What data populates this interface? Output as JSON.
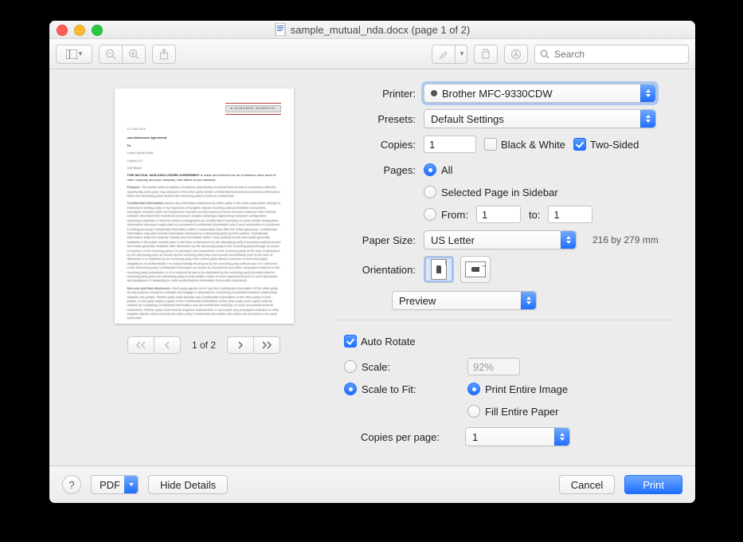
{
  "titlebar": {
    "title": "sample_mutual_nda.docx (page 1 of 2)"
  },
  "toolbar": {
    "search_placeholder": "Search"
  },
  "preview": {
    "page_indicator": "1 of 2",
    "thumb": {
      "logo": "A HUNDRED MONKEYS",
      "date": "10 JUN 2019",
      "heading": "non-disclosure agreement",
      "to_label": "To",
      "block1_title": "THIS MUTUAL NON-DISCLOSURE AGREEMENT"
    }
  },
  "form": {
    "printer": {
      "label": "Printer:",
      "value": "Brother MFC-9330CDW"
    },
    "presets": {
      "label": "Presets:",
      "value": "Default Settings"
    },
    "copies": {
      "label": "Copies:",
      "value": "1",
      "bw_label": "Black & White",
      "two_sided_label": "Two-Sided"
    },
    "pages": {
      "label": "Pages:",
      "all_label": "All",
      "selected_label": "Selected Page in Sidebar",
      "from_label": "From:",
      "from_value": "1",
      "to_label": "to:",
      "to_value": "1"
    },
    "paper_size": {
      "label": "Paper Size:",
      "value": "US Letter",
      "hint": "216 by 279 mm"
    },
    "orientation": {
      "label": "Orientation:"
    },
    "section": {
      "value": "Preview"
    },
    "auto_rotate_label": "Auto Rotate",
    "scale": {
      "scale_label": "Scale:",
      "scale_value": "92%",
      "fit_label": "Scale to Fit:",
      "print_entire_label": "Print Entire Image",
      "fill_paper_label": "Fill Entire Paper"
    },
    "copies_per_page": {
      "label": "Copies per page:",
      "value": "1"
    }
  },
  "footer": {
    "help": "?",
    "pdf_label": "PDF",
    "hide_details": "Hide Details",
    "cancel": "Cancel",
    "print": "Print"
  }
}
